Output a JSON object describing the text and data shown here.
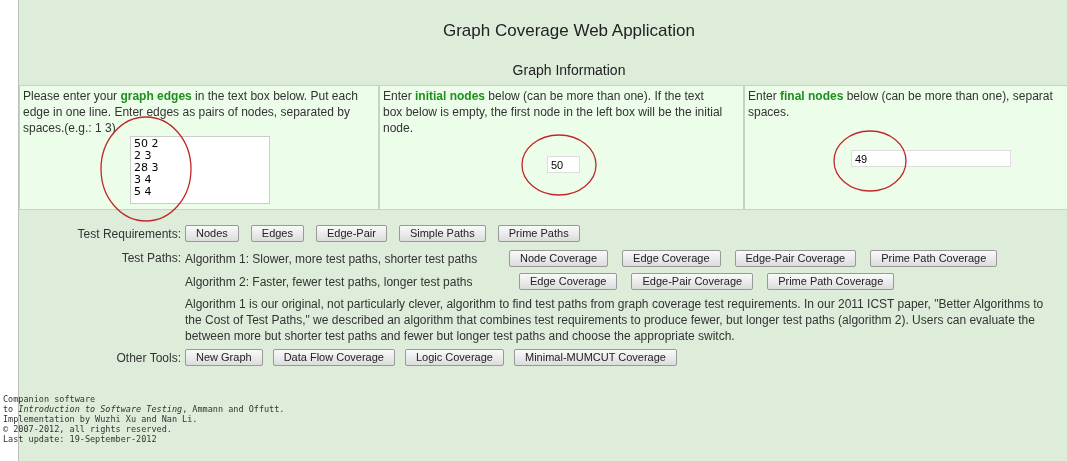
{
  "title": "Graph Coverage Web Application",
  "section_title": "Graph Information",
  "inputs": [
    {
      "kind": "textarea",
      "text": "Please enter your **graph edges** in the text box below. Put each\nedge in one line. Enter edges as pairs of nodes, separated by\nspaces.(e.g.: 1 3)",
      "value": "50 2\n2 3\n28 3\n3 4\n5 4",
      "highlighted": true
    },
    {
      "kind": "small",
      "text": "Enter **initial nodes** below (can be more than one). If the text\nbox below is empty, the first node in the left box will be the initial\nnode.",
      "value": "50",
      "highlighted": true
    },
    {
      "kind": "wide",
      "text": "Enter **final nodes** below (can be more than one), separat\nspaces.",
      "value": "49",
      "highlighted": true
    }
  ],
  "test_requirements": {
    "label": "Test Requirements:",
    "buttons": [
      "Nodes",
      "Edges",
      "Edge-Pair",
      "Simple Paths",
      "Prime Paths"
    ]
  },
  "test_paths": {
    "label": "Test Paths:",
    "algorithms": [
      {
        "text": "Algorithm 1: Slower, more test paths, shorter test paths",
        "buttons": [
          "Node Coverage",
          "Edge Coverage",
          "Edge-Pair Coverage",
          "Prime Path Coverage"
        ]
      },
      {
        "text": "Algorithm 2: Faster, fewer test paths, longer test paths",
        "buttons": [
          "Edge Coverage",
          "Edge-Pair Coverage",
          "Prime Path Coverage"
        ]
      }
    ],
    "description": [
      "Algorithm 1 is our original, not particularly clever, algorithm to find test paths from graph coverage test requirements. In our 2011 ICST paper, \"Better Algorithms to",
      "the Cost of Test Paths,\" we described an algorithm that combines test requirements to produce fewer, but longer test paths (algorithm 2). Users can evaluate the",
      "between more but shorter test paths and fewer but longer test paths and choose the appropriate switch."
    ]
  },
  "other_tools": {
    "label": "Other Tools:",
    "buttons": [
      "New Graph",
      "Data Flow Coverage",
      "Logic Coverage",
      "Minimal-MUMCUT Coverage"
    ]
  },
  "footer": [
    "Companion software",
    "to *Introduction to Software Testing*, Ammann and Offutt.",
    "Implementation by Wuzhi Xu and Nan Li.",
    "© 2007-2012, all rights reserved.",
    "Last update: 19-September-2012"
  ]
}
